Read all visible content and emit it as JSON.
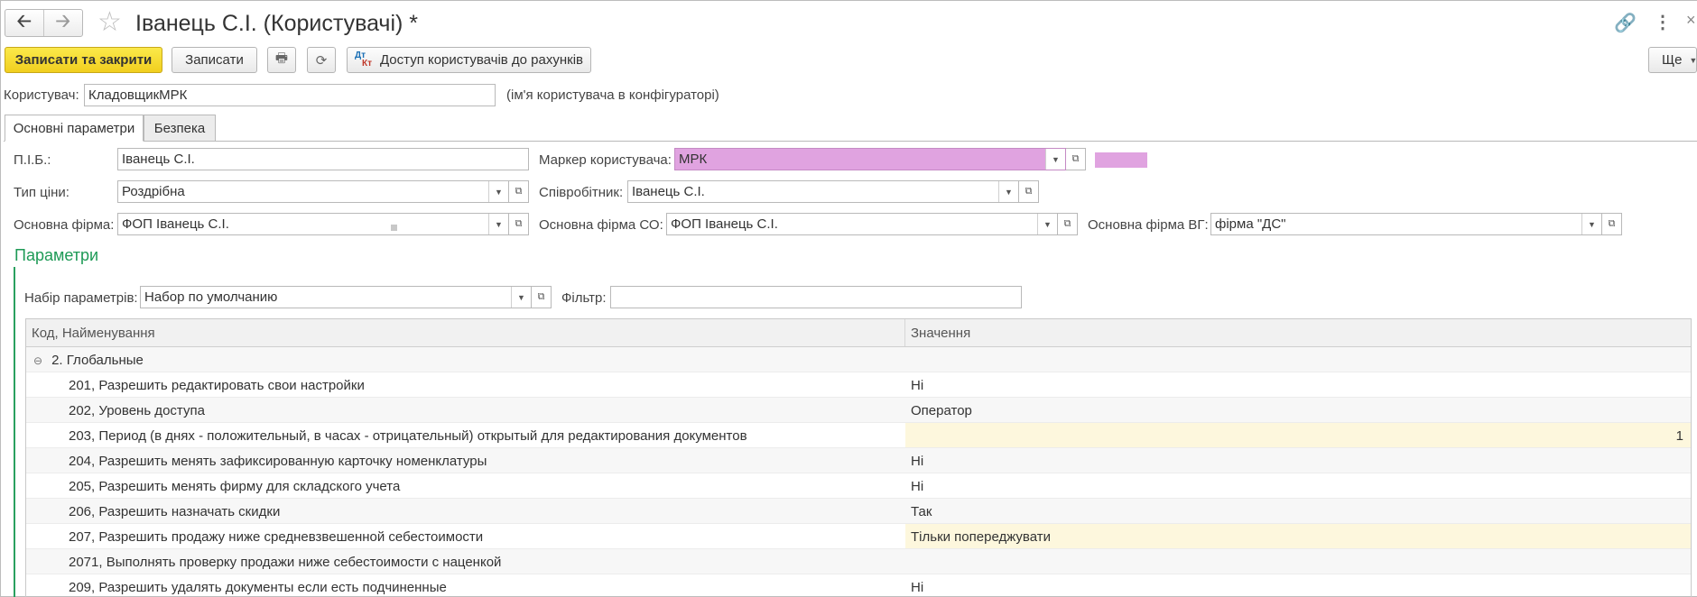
{
  "window": {
    "title": "Іванець С.І. (Користувачі) *"
  },
  "toolbar": {
    "save_close_label": "Записати та закрити",
    "save_label": "Записати",
    "access_label": "Доступ користувачів до рахунків",
    "more_label": "Ще"
  },
  "user": {
    "label": "Користувач:",
    "value": "КладовщикМРК",
    "hint": "(ім'я користувача в конфігураторі)"
  },
  "tabs": [
    {
      "label": "Основні параметри",
      "active": true
    },
    {
      "label": "Безпека",
      "active": false
    }
  ],
  "form": {
    "pib_label": "П.І.Б.:",
    "pib_value": "Іванець С.І.",
    "marker_label": "Маркер користувача:",
    "marker_value": "МРК",
    "marker_color": "#e0a3e0",
    "price_type_label": "Тип ціни:",
    "price_type_value": "Роздрібна",
    "employee_label": "Співробітник:",
    "employee_value": "Іванець С.І.",
    "main_firm_label": "Основна фірма:",
    "main_firm_value": "ФОП Іванець С.І.",
    "main_firm_co_label": "Основна фірма СО:",
    "main_firm_co_value": "ФОП Іванець С.І.",
    "main_firm_vg_label": "Основна фірма ВГ:",
    "main_firm_vg_value": "фірма \"ДС\""
  },
  "params": {
    "section_title": "Параметри",
    "set_label": "Набір параметрів:",
    "set_value": "Набор по умолчанию",
    "filter_label": "Фільтр:",
    "filter_value": ""
  },
  "table": {
    "col_name": "Код, Найменування",
    "col_value": "Значення",
    "group": "2. Глобальные",
    "rows": [
      {
        "name": "201, Разрешить редактировать свои настройки",
        "value": "Ні"
      },
      {
        "name": "202, Уровень доступа",
        "value": "Оператор"
      },
      {
        "name": "203, Период (в днях - положительный, в часах - отрицательный) открытый для редактирования документов",
        "value": "1"
      },
      {
        "name": "204, Разрешить менять зафиксированную карточку номенклатуры",
        "value": "Ні"
      },
      {
        "name": "205, Разрешить менять фирму для складского учета",
        "value": "Ні"
      },
      {
        "name": "206, Разрешить назначать скидки",
        "value": "Так"
      },
      {
        "name": "207, Разрешить продажу ниже средневзвешенной себестоимости",
        "value": "Тільки попереджувати"
      },
      {
        "name": "2071, Выполнять проверку продажи ниже себестоимости с наценкой",
        "value": ""
      },
      {
        "name": "209, Разрешить удалять документы если есть подчиненные",
        "value": "Ні"
      }
    ]
  },
  "colors": {
    "accent_green": "#2aa05f",
    "primary_button": "#f1cf1f",
    "highlight_row": "#fdf7dd"
  }
}
